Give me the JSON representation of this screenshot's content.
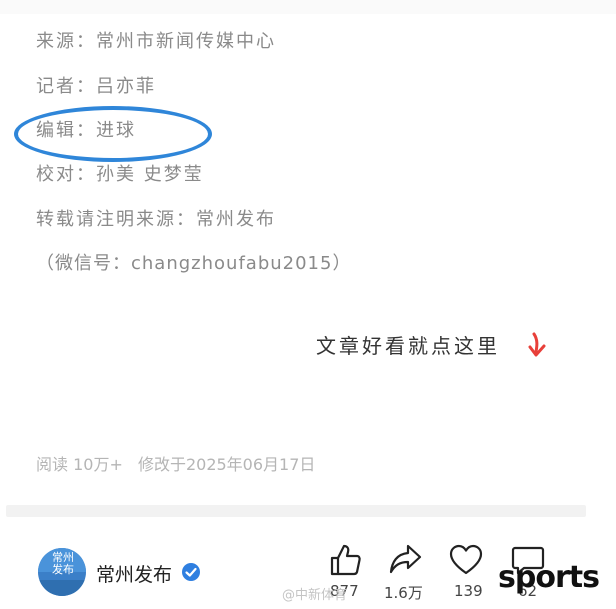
{
  "article": {
    "meta": [
      {
        "label": "来源：",
        "value": "常州市新闻传媒中心"
      },
      {
        "label": "记者：",
        "value": "吕亦菲"
      },
      {
        "label": "编辑：",
        "value": "进球"
      },
      {
        "label": "校对：",
        "value": "孙美 史梦莹"
      },
      {
        "label": "转载请注明来源：",
        "value": "常州发布"
      },
      {
        "label": "（微信号：",
        "value": "changzhoufabu2015）"
      }
    ],
    "cta": "文章好看就点这里",
    "reads": "阅读 10万+",
    "modified": "修改于2025年06月17日"
  },
  "account": {
    "avatar_text": "常州\n发布",
    "name": "常州发布"
  },
  "actions": {
    "like_count": "877",
    "share_count": "1.6万",
    "favorite_count": "139",
    "comment_count": "62"
  },
  "overlay": {
    "watermark": "@中新体育",
    "brand": "sports"
  },
  "colors": {
    "highlight_circle": "#2f86d9",
    "cta_arrow": "#e8403a",
    "verified_badge": "#2f7fe0"
  },
  "icons": [
    "thumbs-up-icon",
    "share-arrow-icon",
    "heart-icon",
    "comment-bubble-icon",
    "verified-icon",
    "down-arrow-icon"
  ]
}
